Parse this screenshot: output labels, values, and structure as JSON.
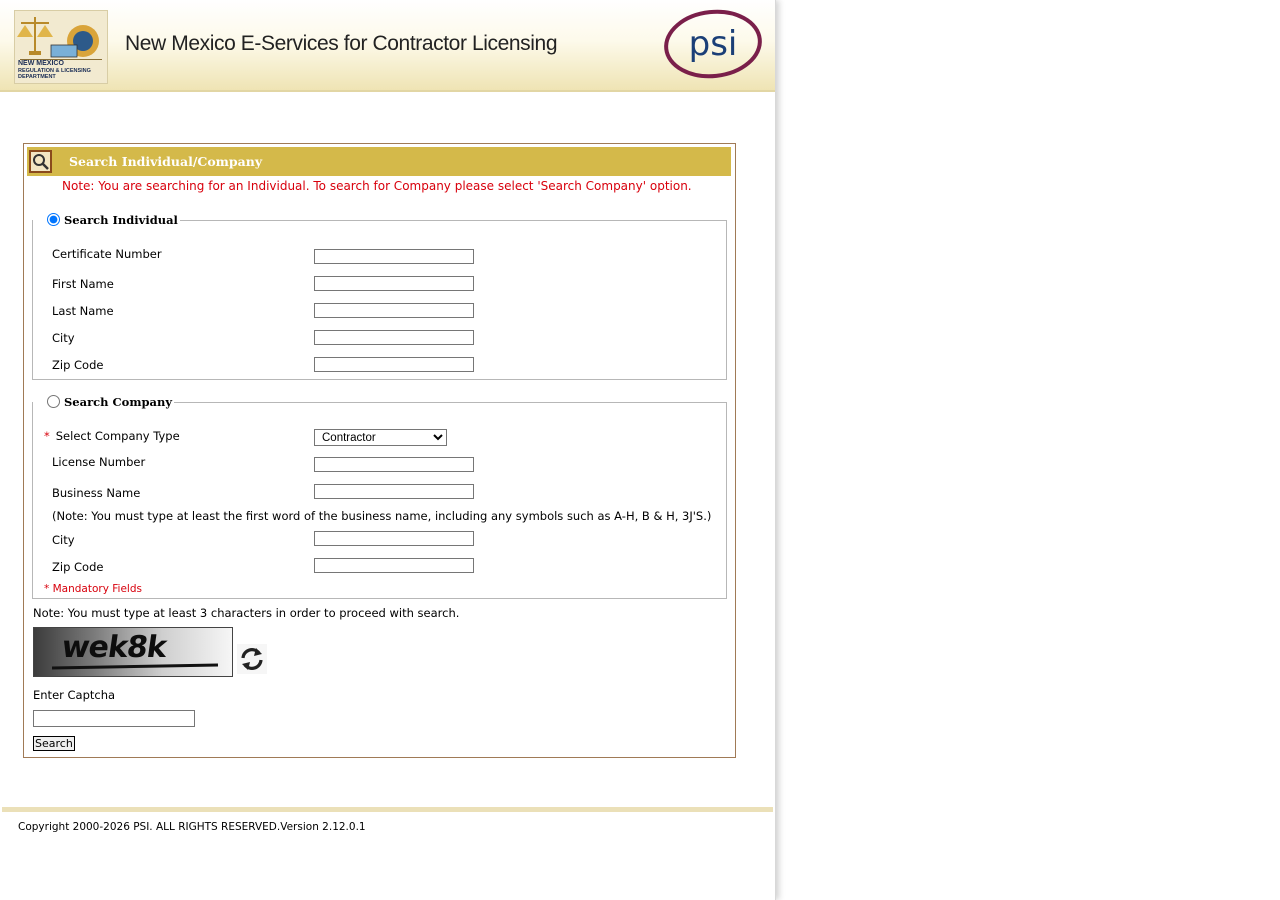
{
  "header": {
    "title": "New Mexico E-Services for Contractor Licensing",
    "dept_logo_text": [
      "NEW MEXICO",
      "REGULATION & LICENSING DEPARTMENT"
    ],
    "psi_logo_text": "psi"
  },
  "panel": {
    "title": "Search Individual/Company",
    "note": "Note: You are searching for an Individual. To search for Company please select 'Search Company' option."
  },
  "individual": {
    "legend": "Search Individual",
    "selected": true,
    "fields": {
      "certificate_number": "Certificate Number",
      "first_name": "First Name",
      "last_name": "Last Name",
      "city": "City",
      "zip_code": "Zip Code"
    }
  },
  "company": {
    "legend": "Search Company",
    "selected": false,
    "required_marker": "*",
    "select_company_type_label": "Select Company Type",
    "company_type_value": "Contractor",
    "license_number": "License Number",
    "business_name": "Business Name",
    "business_note": "(Note: You must type at least the first word of the business name, including any symbols such as A-H, B & H, 3J'S.)",
    "city": "City",
    "zip_code": "Zip Code",
    "mandatory_note": "* Mandatory Fields"
  },
  "search": {
    "min_chars_note": "Note: You must type at least 3 characters in order to proceed with search.",
    "captcha_text": "wek8k",
    "enter_captcha_label": "Enter Captcha",
    "search_button": "Search"
  },
  "footer": {
    "copyright": "Copyright 2000-2026 PSI. ALL RIGHTS RESERVED.Version 2.12.0.1"
  },
  "colors": {
    "panel_header": "#d4b94a",
    "note_red": "#d8000c",
    "psi_purple": "#7a1f4a",
    "psi_blue": "#1b3f77"
  },
  "icons": {
    "panel": "search-magnifier-icon",
    "refresh": "refresh-icon"
  }
}
